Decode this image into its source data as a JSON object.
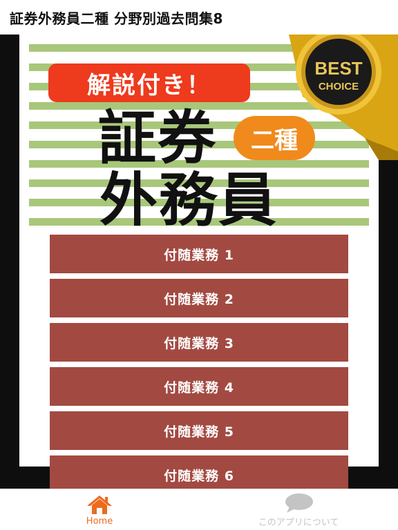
{
  "header": {
    "title": "証券外務員二種 分野別過去問集8"
  },
  "banner": {
    "tagline": "解説付き！",
    "title_line1": "証券",
    "grade": "二種",
    "title_line2": "外務員",
    "badge_line1": "BEST",
    "badge_line2": "CHOICE"
  },
  "menu": {
    "items": [
      {
        "label": "付随業務 1"
      },
      {
        "label": "付随業務 2"
      },
      {
        "label": "付随業務 3"
      },
      {
        "label": "付随業務 4"
      },
      {
        "label": "付随業務 5"
      },
      {
        "label": "付随業務 6"
      }
    ]
  },
  "bottom_nav": {
    "tabs": [
      {
        "label": "Home",
        "icon": "home-icon",
        "active": true
      },
      {
        "label": "このアプリについて",
        "icon": "speech-bubble-icon",
        "active": false
      }
    ]
  },
  "colors": {
    "menu_button": "#a24a42",
    "stripe": "#a8c77a",
    "tagline_pill": "#ee3a1d",
    "grade_circle": "#f08a1c",
    "active_tab": "#ee6a1d",
    "inactive_tab": "#c4c4c4"
  }
}
